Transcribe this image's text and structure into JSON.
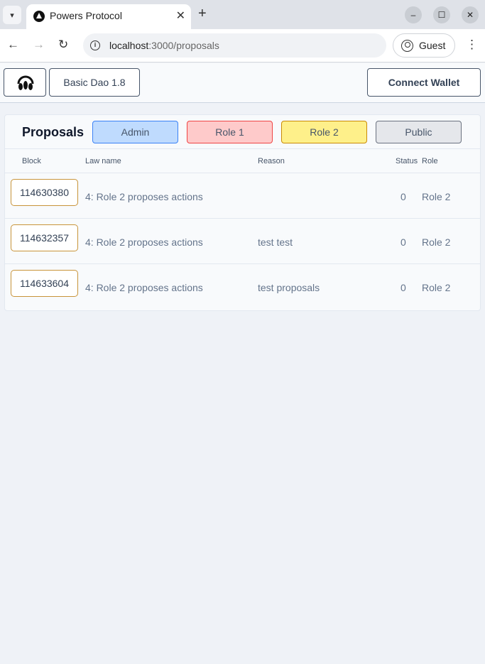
{
  "browser": {
    "tab_title": "Powers Protocol",
    "url_host": "localhost",
    "url_path": ":3000/proposals",
    "profile_label": "Guest",
    "new_tab": "+",
    "close_tab": "✕"
  },
  "nav": {
    "dao_name": "Basic Dao 1.8",
    "connect_wallet": "Connect Wallet"
  },
  "proposals": {
    "title": "Proposals",
    "filters": [
      {
        "label": "Admin",
        "bg": "#bfdbfe",
        "border": "#3b82f6"
      },
      {
        "label": "Role 1",
        "bg": "#fecaca",
        "border": "#ef4444"
      },
      {
        "label": "Role 2",
        "bg": "#fef08a",
        "border": "#ca8a04"
      },
      {
        "label": "Public",
        "bg": "#e5e7eb",
        "border": "#6b7280"
      }
    ],
    "columns": [
      "Block",
      "Law name",
      "Reason",
      "Status",
      "Role"
    ],
    "rows": [
      {
        "block": "114630380",
        "law": "4: Role 2 proposes actions",
        "reason": "",
        "status": "0",
        "role": "Role 2"
      },
      {
        "block": "114632357",
        "law": "4: Role 2 proposes actions",
        "reason": "test test",
        "status": "0",
        "role": "Role 2"
      },
      {
        "block": "114633604",
        "law": "4: Role 2 proposes actions",
        "reason": "test proposals",
        "status": "0",
        "role": "Role 2"
      }
    ]
  }
}
